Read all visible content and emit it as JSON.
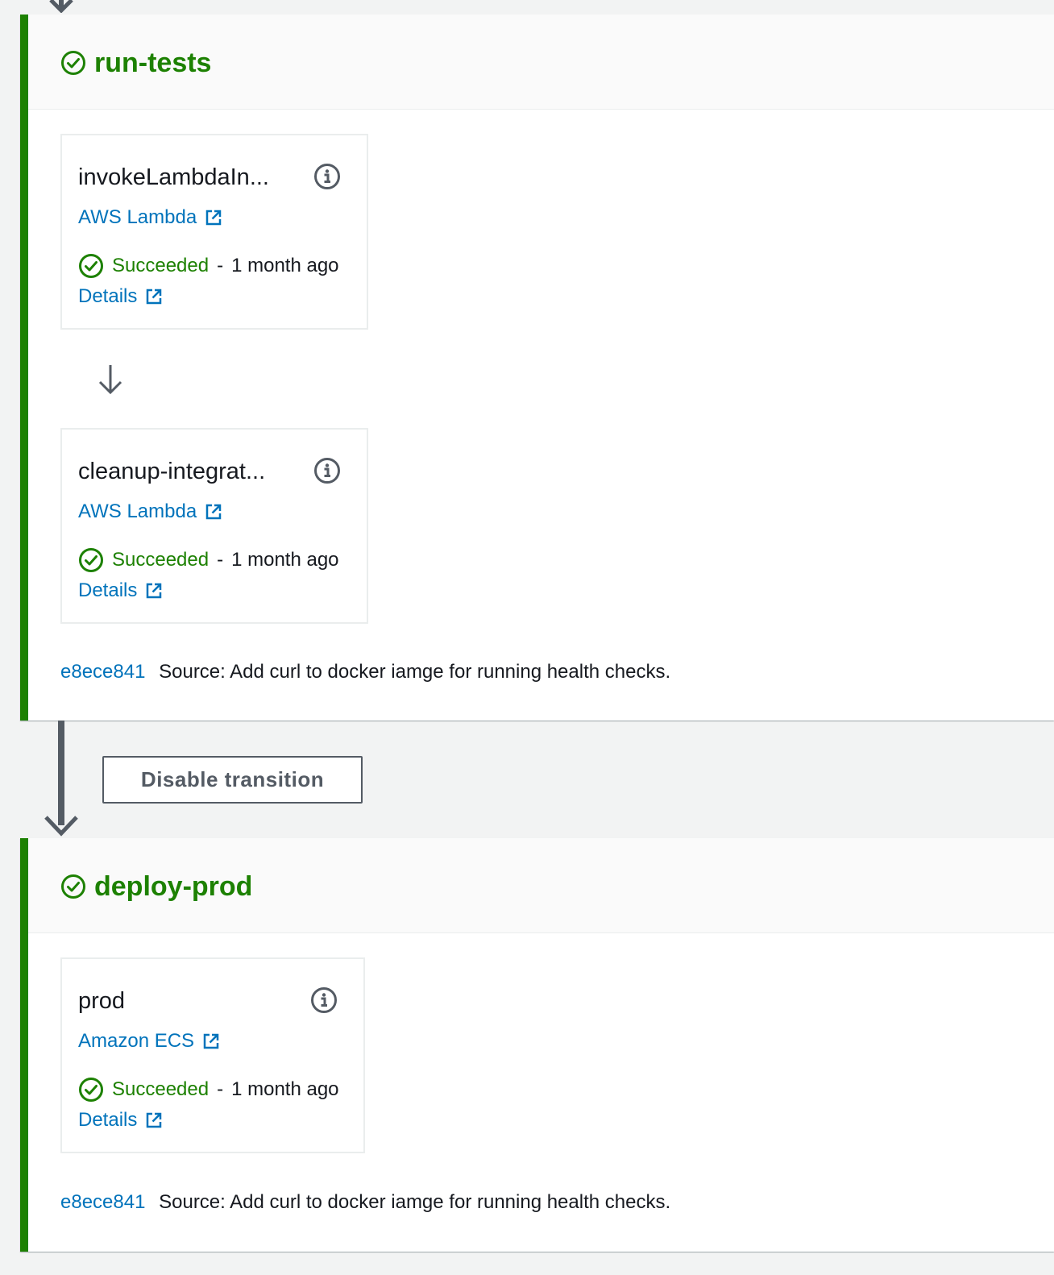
{
  "colors": {
    "success": "#1d8102",
    "link": "#0073bb",
    "text": "#16191f",
    "muted": "#545b64",
    "background": "#f2f3f3"
  },
  "stages": [
    {
      "name": "run-tests",
      "status_icon": "check-circle-icon",
      "actions": [
        {
          "name": "invokeLambdaIn...",
          "provider": "AWS Lambda",
          "status": "Succeeded",
          "separator": "-",
          "time": "1 month ago",
          "details_label": "Details"
        },
        {
          "name": "cleanup-integrat...",
          "provider": "AWS Lambda",
          "status": "Succeeded",
          "separator": "-",
          "time": "1 month ago",
          "details_label": "Details"
        }
      ],
      "revision": {
        "commit_id": "e8ece841",
        "message": "Source: Add curl to docker iamge for running health checks."
      }
    },
    {
      "name": "deploy-prod",
      "status_icon": "check-circle-icon",
      "actions": [
        {
          "name": "prod",
          "provider": "Amazon ECS",
          "status": "Succeeded",
          "separator": "-",
          "time": "1 month ago",
          "details_label": "Details"
        }
      ],
      "revision": {
        "commit_id": "e8ece841",
        "message": "Source: Add curl to docker iamge for running health checks."
      }
    }
  ],
  "transition": {
    "button_label": "Disable transition"
  }
}
